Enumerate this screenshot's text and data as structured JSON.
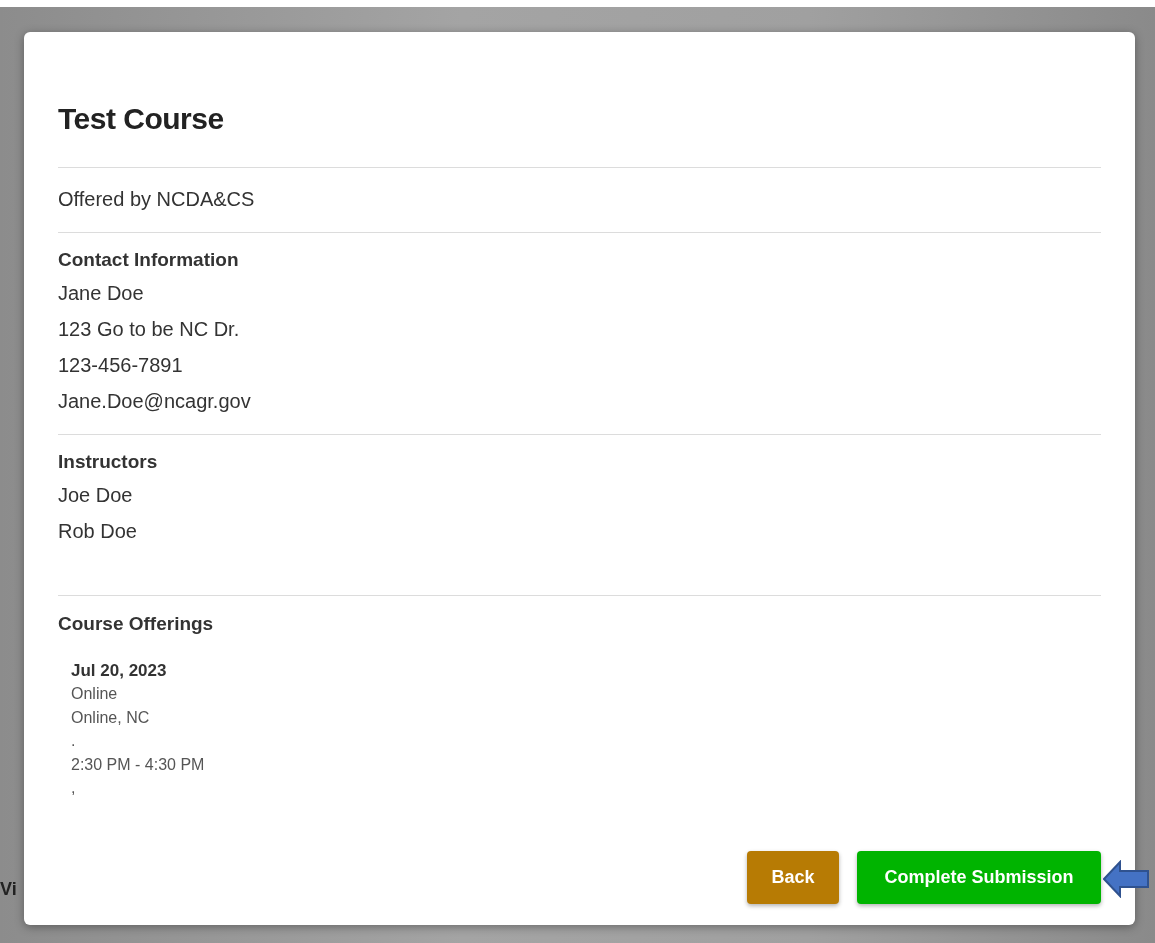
{
  "backdrop": {
    "text": "Vi"
  },
  "dialog": {
    "title": "Test Course",
    "offered_by": "Offered by NCDA&CS",
    "contact": {
      "heading": "Contact Information",
      "lines": [
        "Jane Doe",
        "123 Go to be NC Dr.",
        "123-456-7891",
        "Jane.Doe@ncagr.gov"
      ]
    },
    "instructors": {
      "heading": "Instructors",
      "names": [
        "Joe Doe",
        "Rob Doe"
      ]
    },
    "offerings": {
      "heading": "Course Offerings",
      "items": [
        {
          "date": "Jul 20, 2023",
          "lines": [
            "Online",
            "Online, NC",
            ".",
            "2:30 PM - 4:30 PM",
            ","
          ]
        }
      ]
    },
    "buttons": [
      {
        "label": "Back",
        "kind": "back"
      },
      {
        "label": "Complete Submission",
        "kind": "submit"
      }
    ]
  }
}
